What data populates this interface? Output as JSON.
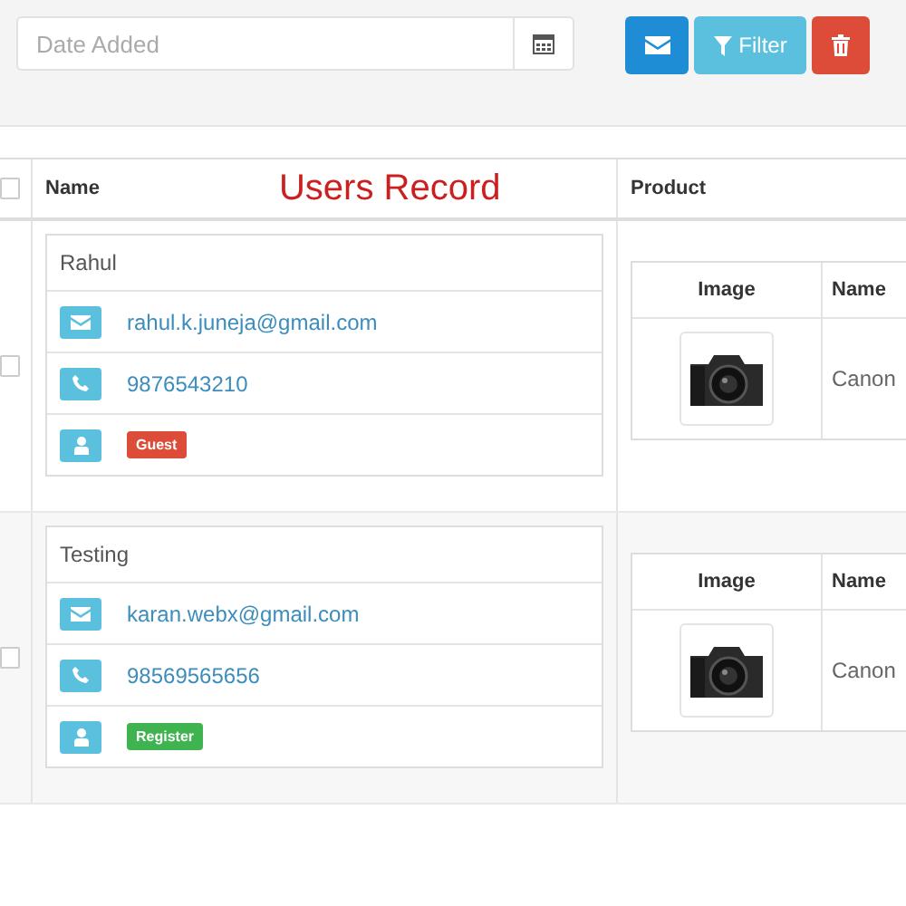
{
  "filter_bar": {
    "date_field": {
      "placeholder": "Date Added"
    },
    "buttons": [
      {
        "kind": "mail"
      },
      {
        "kind": "filter",
        "label": "Filter"
      },
      {
        "kind": "delete"
      }
    ]
  },
  "table": {
    "title": "Users Record",
    "select_all": {
      "checked": false
    },
    "columns": [
      "Name",
      "Product"
    ],
    "rows": [
      {
        "checked": false,
        "user": {
          "name": "Rahul",
          "email": "rahul.k.juneja@gmail.com",
          "phone": "9876543210",
          "role": {
            "label": "Guest",
            "color": "#dd4b39"
          }
        },
        "product": {
          "columns": [
            "Image",
            "Name"
          ],
          "name": "Canon"
        }
      },
      {
        "checked": false,
        "user": {
          "name": "Testing",
          "email": "karan.webx@gmail.com",
          "phone": "98569565656",
          "role": {
            "label": "Register",
            "color": "#3fb34f"
          }
        },
        "product": {
          "columns": [
            "Image",
            "Name"
          ],
          "name": "Canon"
        }
      }
    ]
  }
}
